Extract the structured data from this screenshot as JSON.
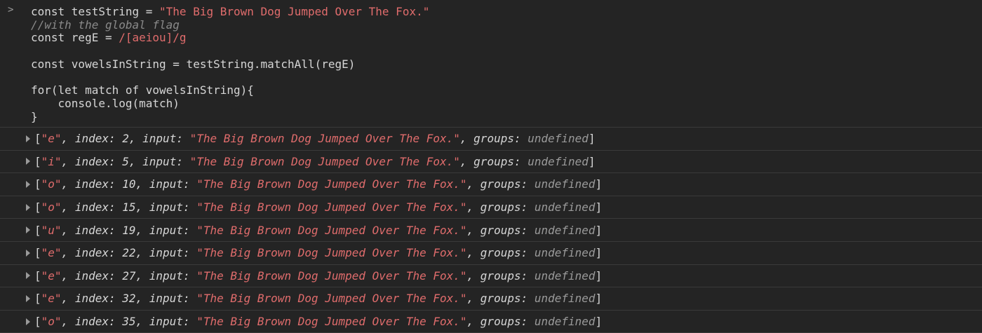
{
  "prompt_symbol": ">",
  "code_lines": [
    [
      {
        "t": "kw",
        "v": "const testString = "
      },
      {
        "t": "str",
        "v": "\"The Big Brown Dog Jumped Over The Fox.\""
      }
    ],
    [
      {
        "t": "cmt",
        "v": "//with the global flag"
      }
    ],
    [
      {
        "t": "kw",
        "v": "const regE = "
      },
      {
        "t": "str",
        "v": "/[aeiou]/g"
      }
    ],
    [
      {
        "t": "kw",
        "v": ""
      }
    ],
    [
      {
        "t": "kw",
        "v": "const vowelsInString = testString.matchAll(regE)"
      }
    ],
    [
      {
        "t": "kw",
        "v": ""
      }
    ],
    [
      {
        "t": "kw",
        "v": "for(let match of vowelsInString){"
      }
    ],
    [
      {
        "t": "kw",
        "v": "    console.log(match)"
      }
    ],
    [
      {
        "t": "kw",
        "v": "}"
      }
    ]
  ],
  "labels": {
    "index": "index: ",
    "input": "input: ",
    "groups": "groups: "
  },
  "input_string": "\"The Big Brown Dog Jumped Over The Fox.\"",
  "groups_value": "undefined",
  "results": [
    {
      "match": "\"e\"",
      "index": "2"
    },
    {
      "match": "\"i\"",
      "index": "5"
    },
    {
      "match": "\"o\"",
      "index": "10"
    },
    {
      "match": "\"o\"",
      "index": "15"
    },
    {
      "match": "\"u\"",
      "index": "19"
    },
    {
      "match": "\"e\"",
      "index": "22"
    },
    {
      "match": "\"e\"",
      "index": "27"
    },
    {
      "match": "\"e\"",
      "index": "32"
    },
    {
      "match": "\"o\"",
      "index": "35"
    }
  ]
}
